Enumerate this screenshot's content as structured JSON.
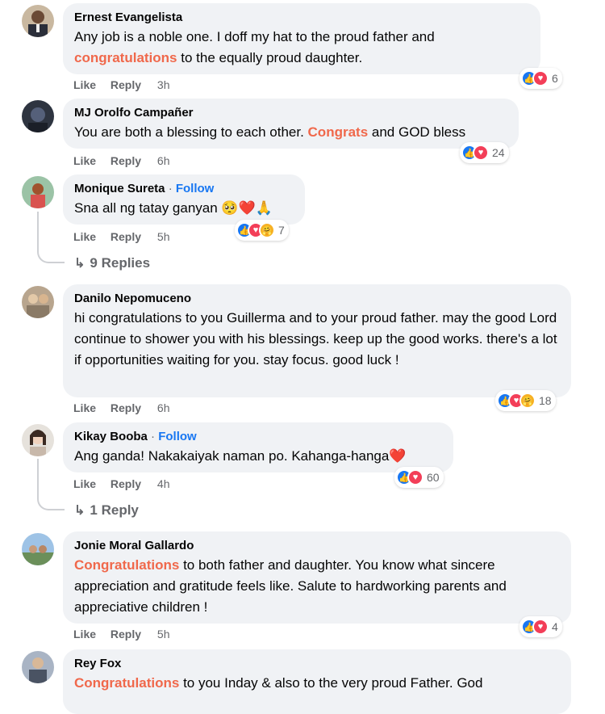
{
  "comments": [
    {
      "author": "Ernest Evangelista",
      "parts": [
        {
          "t": "Any job is a noble one. I doff my hat to the proud father and"
        },
        {
          "t": "congratulations",
          "h": true
        },
        {
          "t": " to the equally proud daughter."
        }
      ],
      "like": "Like",
      "reply": "Reply",
      "time": "3h",
      "reaction_count": "6"
    },
    {
      "author": "MJ Orolfo Campañer",
      "parts": [
        {
          "t": "You are both a blessing to each other. "
        },
        {
          "t": "Congrats",
          "h": true
        },
        {
          "t": " and GOD bless"
        }
      ],
      "like": "Like",
      "reply": "Reply",
      "time": "6h",
      "reaction_count": "24"
    },
    {
      "author": "Monique Sureta",
      "separator": "·",
      "follow": "Follow",
      "parts": [
        {
          "t": "Sna all ng tatay ganyan 🥺❤️🙏"
        }
      ],
      "like": "Like",
      "reply": "Reply",
      "time": "5h",
      "reaction_count": "7",
      "replies": "9 Replies"
    },
    {
      "author": "Danilo Nepomuceno",
      "parts": [
        {
          "t": "hi congratulations to you Guillerma and to your proud father. may the good Lord continue to shower you with his blessings. keep up the good works. there's a lot if opportunities waiting for you. stay focus. good luck !"
        }
      ],
      "like": "Like",
      "reply": "Reply",
      "time": "6h",
      "reaction_count": "18"
    },
    {
      "author": "Kikay Booba",
      "separator": "·",
      "follow": "Follow",
      "parts": [
        {
          "t": "Ang ganda! Nakakaiyak naman po. Kahanga-hanga❤️"
        }
      ],
      "like": "Like",
      "reply": "Reply",
      "time": "4h",
      "reaction_count": "60",
      "replies": "1 Reply"
    },
    {
      "author": "Jonie Moral Gallardo",
      "parts": [
        {
          "t": "Congratulations",
          "h": true
        },
        {
          "t": " to both father and daughter. You know what sincere appreciation and gratitude feels like. Salute to hardworking parents and appreciative children !"
        }
      ],
      "like": "Like",
      "reply": "Reply",
      "time": "5h",
      "reaction_count": "4"
    },
    {
      "author": "Rey Fox",
      "parts": [
        {
          "t": "Congratulations",
          "h": true
        },
        {
          "t": " to you Inday & also to the very proud Father. God"
        }
      ]
    }
  ],
  "colors": {
    "highlight": "#f0684b",
    "link": "#1877f2",
    "bubble": "#f0f2f5",
    "meta": "#65676b"
  },
  "reaction_icons": [
    "like-icon",
    "love-icon",
    "care-icon"
  ]
}
